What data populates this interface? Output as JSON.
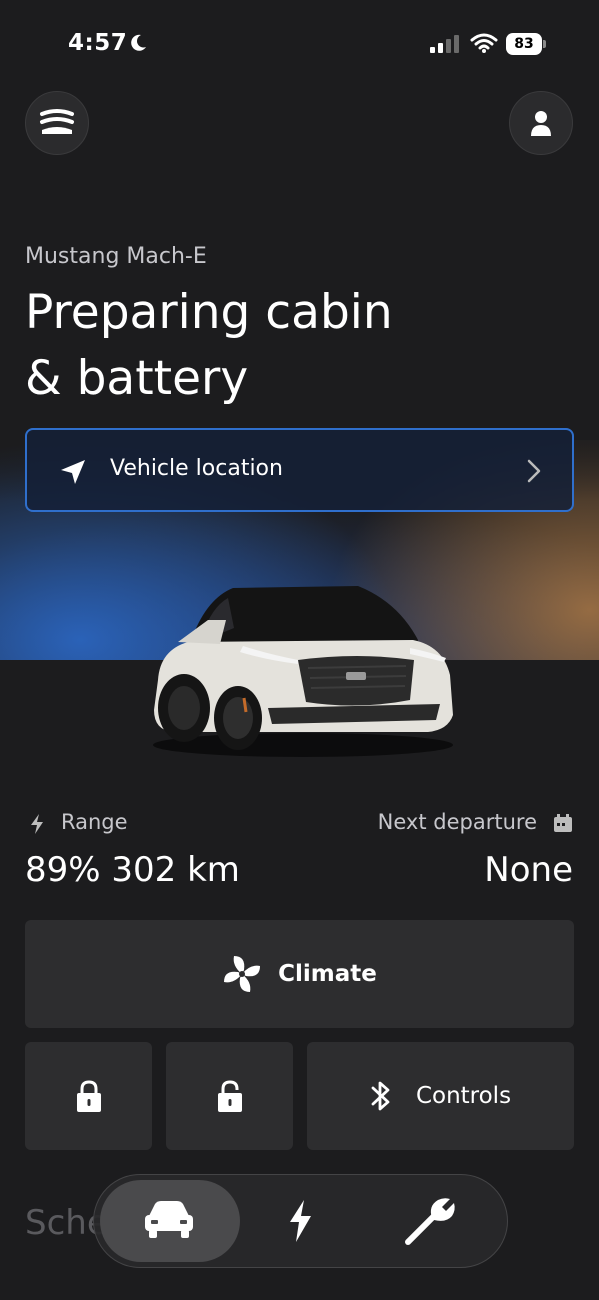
{
  "status_bar": {
    "time": "4:57",
    "battery": "83"
  },
  "header": {
    "menu_icon": "vehicle-menu-icon",
    "profile_icon": "person-icon"
  },
  "vehicle": {
    "model": "Mustang Mach-E",
    "status_line1": "Preparing cabin",
    "status_line2": "& battery"
  },
  "location_button": {
    "label": "Vehicle location"
  },
  "range": {
    "label": "Range",
    "value": "89% 302 km"
  },
  "departure": {
    "label": "Next departure",
    "value": "None"
  },
  "tiles": {
    "climate_label": "Climate",
    "controls_label": "Controls"
  },
  "section_partial": "Sche",
  "nav": {
    "items": [
      {
        "name": "vehicle",
        "icon": "car-icon",
        "active": true
      },
      {
        "name": "charging",
        "icon": "bolt-icon",
        "active": false
      },
      {
        "name": "service",
        "icon": "wrench-icon",
        "active": false
      }
    ]
  },
  "colors": {
    "accent": "#2f6fcc",
    "background": "#1c1c1e",
    "tile": "#2d2d2f"
  }
}
